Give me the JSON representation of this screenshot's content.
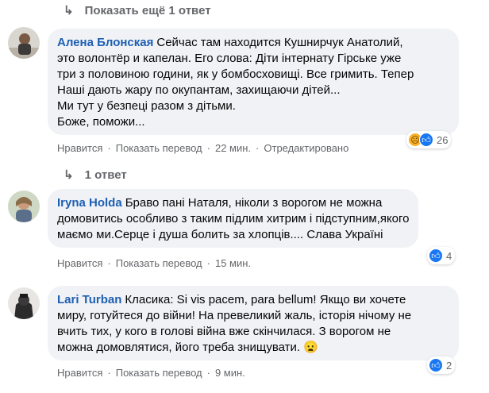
{
  "colors": {
    "link": "#1d5fb3",
    "muted": "#65676b",
    "bubble": "#f0f2f5",
    "like": "#1877f2",
    "sad": "#f7b125"
  },
  "top_replies_toggle": {
    "label": "Показать ещё 1 ответ"
  },
  "comment1": {
    "author": "Алена Блонская",
    "lines": [
      "Сейчас там находится Кушнирчук Анатолий,",
      "это волонтёр и капелан. Его слова: Діти інтернату Гірське уже",
      "три з половиною години, як у бомбосховищі. Все гримить. Тепер",
      "Наші дають жару по окупантам, захищаючи дітей...",
      "Ми тут у безпеці разом з дітьми.",
      "Боже, поможи..."
    ],
    "like": "Нравится",
    "translate": "Показать перевод",
    "time": "22 мин.",
    "edited": "Отредактировано",
    "reaction_count": "26",
    "reaction_icons": [
      "sad-emoji-icon",
      "like-icon"
    ]
  },
  "replies_toggle": {
    "label": "1 ответ"
  },
  "comment2": {
    "author": "Iryna Holda",
    "lines": [
      "Браво пані Наталя, ніколи з ворогом не можна",
      "домовитись особливо з таким підлим хитрим і підступним,якого",
      "маємо ми.Серце і душа болить за хлопців.... Слава Україні"
    ],
    "like": "Нравится",
    "translate": "Показать перевод",
    "time": "15 мин.",
    "reaction_count": "4",
    "reaction_icons": [
      "like-icon"
    ]
  },
  "comment3": {
    "author": "Lari Turban",
    "lines": [
      "Класика: Si vis pacem, para bellum! Якщо ви хочете",
      "миру, готуйтеся до війни! На превеликий жаль, історія нічому не",
      "вчить тих, у кого в голові війна вже скінчилася. З ворогом не",
      "можна домовлятися, його треба знищувати. 😦"
    ],
    "like": "Нравится",
    "translate": "Показать перевод",
    "time": "9 мин.",
    "reaction_count": "2",
    "reaction_icons": [
      "like-icon"
    ]
  }
}
